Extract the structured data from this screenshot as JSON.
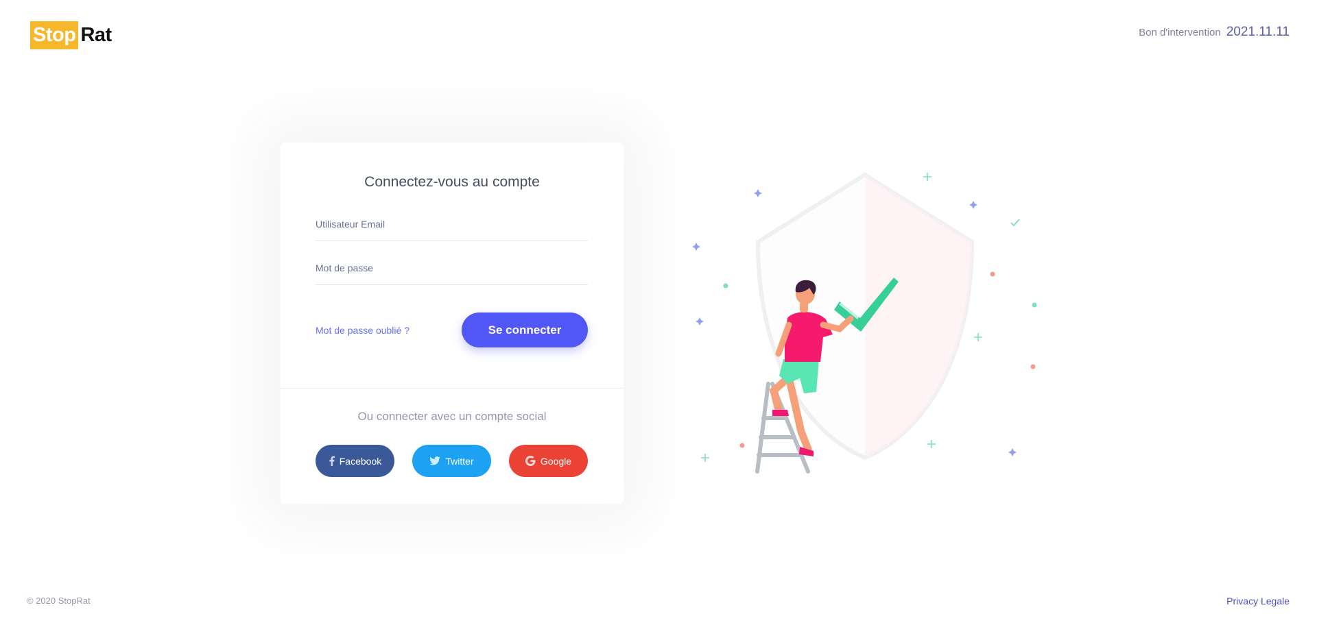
{
  "brand": {
    "logo_part1": "Stop",
    "logo_part2": "Rat",
    "accent_color": "#f6b72a"
  },
  "header": {
    "intervention_label": "Bon d'intervention",
    "intervention_value": "2021.11.11"
  },
  "login": {
    "title": "Connectez-vous au compte",
    "email_placeholder": "Utilisateur Email",
    "password_placeholder": "Mot de passe",
    "forgot_label": "Mot de passe oublié ?",
    "submit_label": "Se connecter",
    "submit_color": "#5057f6"
  },
  "social": {
    "title": "Ou connecter avec un compte social",
    "buttons": [
      {
        "label": "Facebook",
        "icon": "facebook-icon",
        "color": "#3b5998"
      },
      {
        "label": "Twitter",
        "icon": "twitter-icon",
        "color": "#1da1f2"
      },
      {
        "label": "Google",
        "icon": "google-icon",
        "color": "#ea4335"
      }
    ]
  },
  "illustration": {
    "icon": "person-on-ladder-shield-check-illustration"
  },
  "footer": {
    "copyright": "© 2020 StopRat",
    "privacy_label": "Privacy Legale"
  }
}
